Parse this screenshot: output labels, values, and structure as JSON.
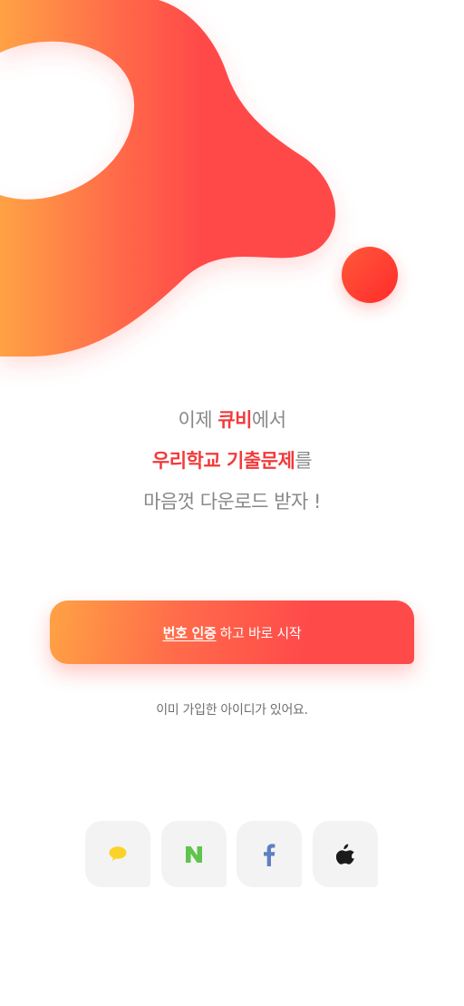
{
  "headline": {
    "line1_prefix": "이제 ",
    "line1_brand": "큐비",
    "line1_suffix": "에서",
    "line2_highlight": "우리학교 기출문제",
    "line2_suffix": "를",
    "line3": "마음껏 다운로드 받자 !"
  },
  "cta": {
    "underlined": "번호 인증",
    "rest": "하고 바로 시작"
  },
  "login_link": "이미 가입한 아이디가 있어요.",
  "social": [
    {
      "name": "kakao",
      "icon": "kakao-chat-icon",
      "color": "#fbd22a"
    },
    {
      "name": "naver",
      "icon": "naver-n-icon",
      "color": "#5fc44c"
    },
    {
      "name": "facebook",
      "icon": "facebook-f-icon",
      "color": "#5f7fc4"
    },
    {
      "name": "apple",
      "icon": "apple-icon",
      "color": "#1a1a1a"
    }
  ],
  "colors": {
    "brand_red": "#f23a3a",
    "gradient_orange": "#ffa244",
    "gradient_red": "#ff4a4a"
  }
}
